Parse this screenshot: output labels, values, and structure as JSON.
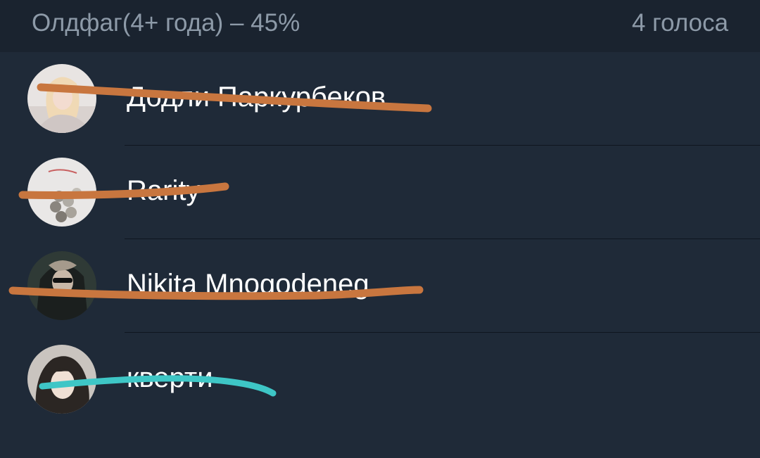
{
  "poll_option": {
    "title": "Олдфаг(4+ года) – 45%",
    "votes": "4 голоса"
  },
  "voters": [
    {
      "name": "Додли Паркурбеков",
      "avatar": "avatar-blonde-girl-icon",
      "strike_color": "#c8763f"
    },
    {
      "name": "Rarity",
      "avatar": "avatar-coins-icon",
      "strike_color": "#c8763f"
    },
    {
      "name": "Nikita Mnogodeneg",
      "avatar": "avatar-hooded-guy-icon",
      "strike_color": "#c8763f"
    },
    {
      "name": "кверти",
      "avatar": "avatar-anime-girl-icon",
      "strike_color": "#3ec6c6"
    }
  ]
}
